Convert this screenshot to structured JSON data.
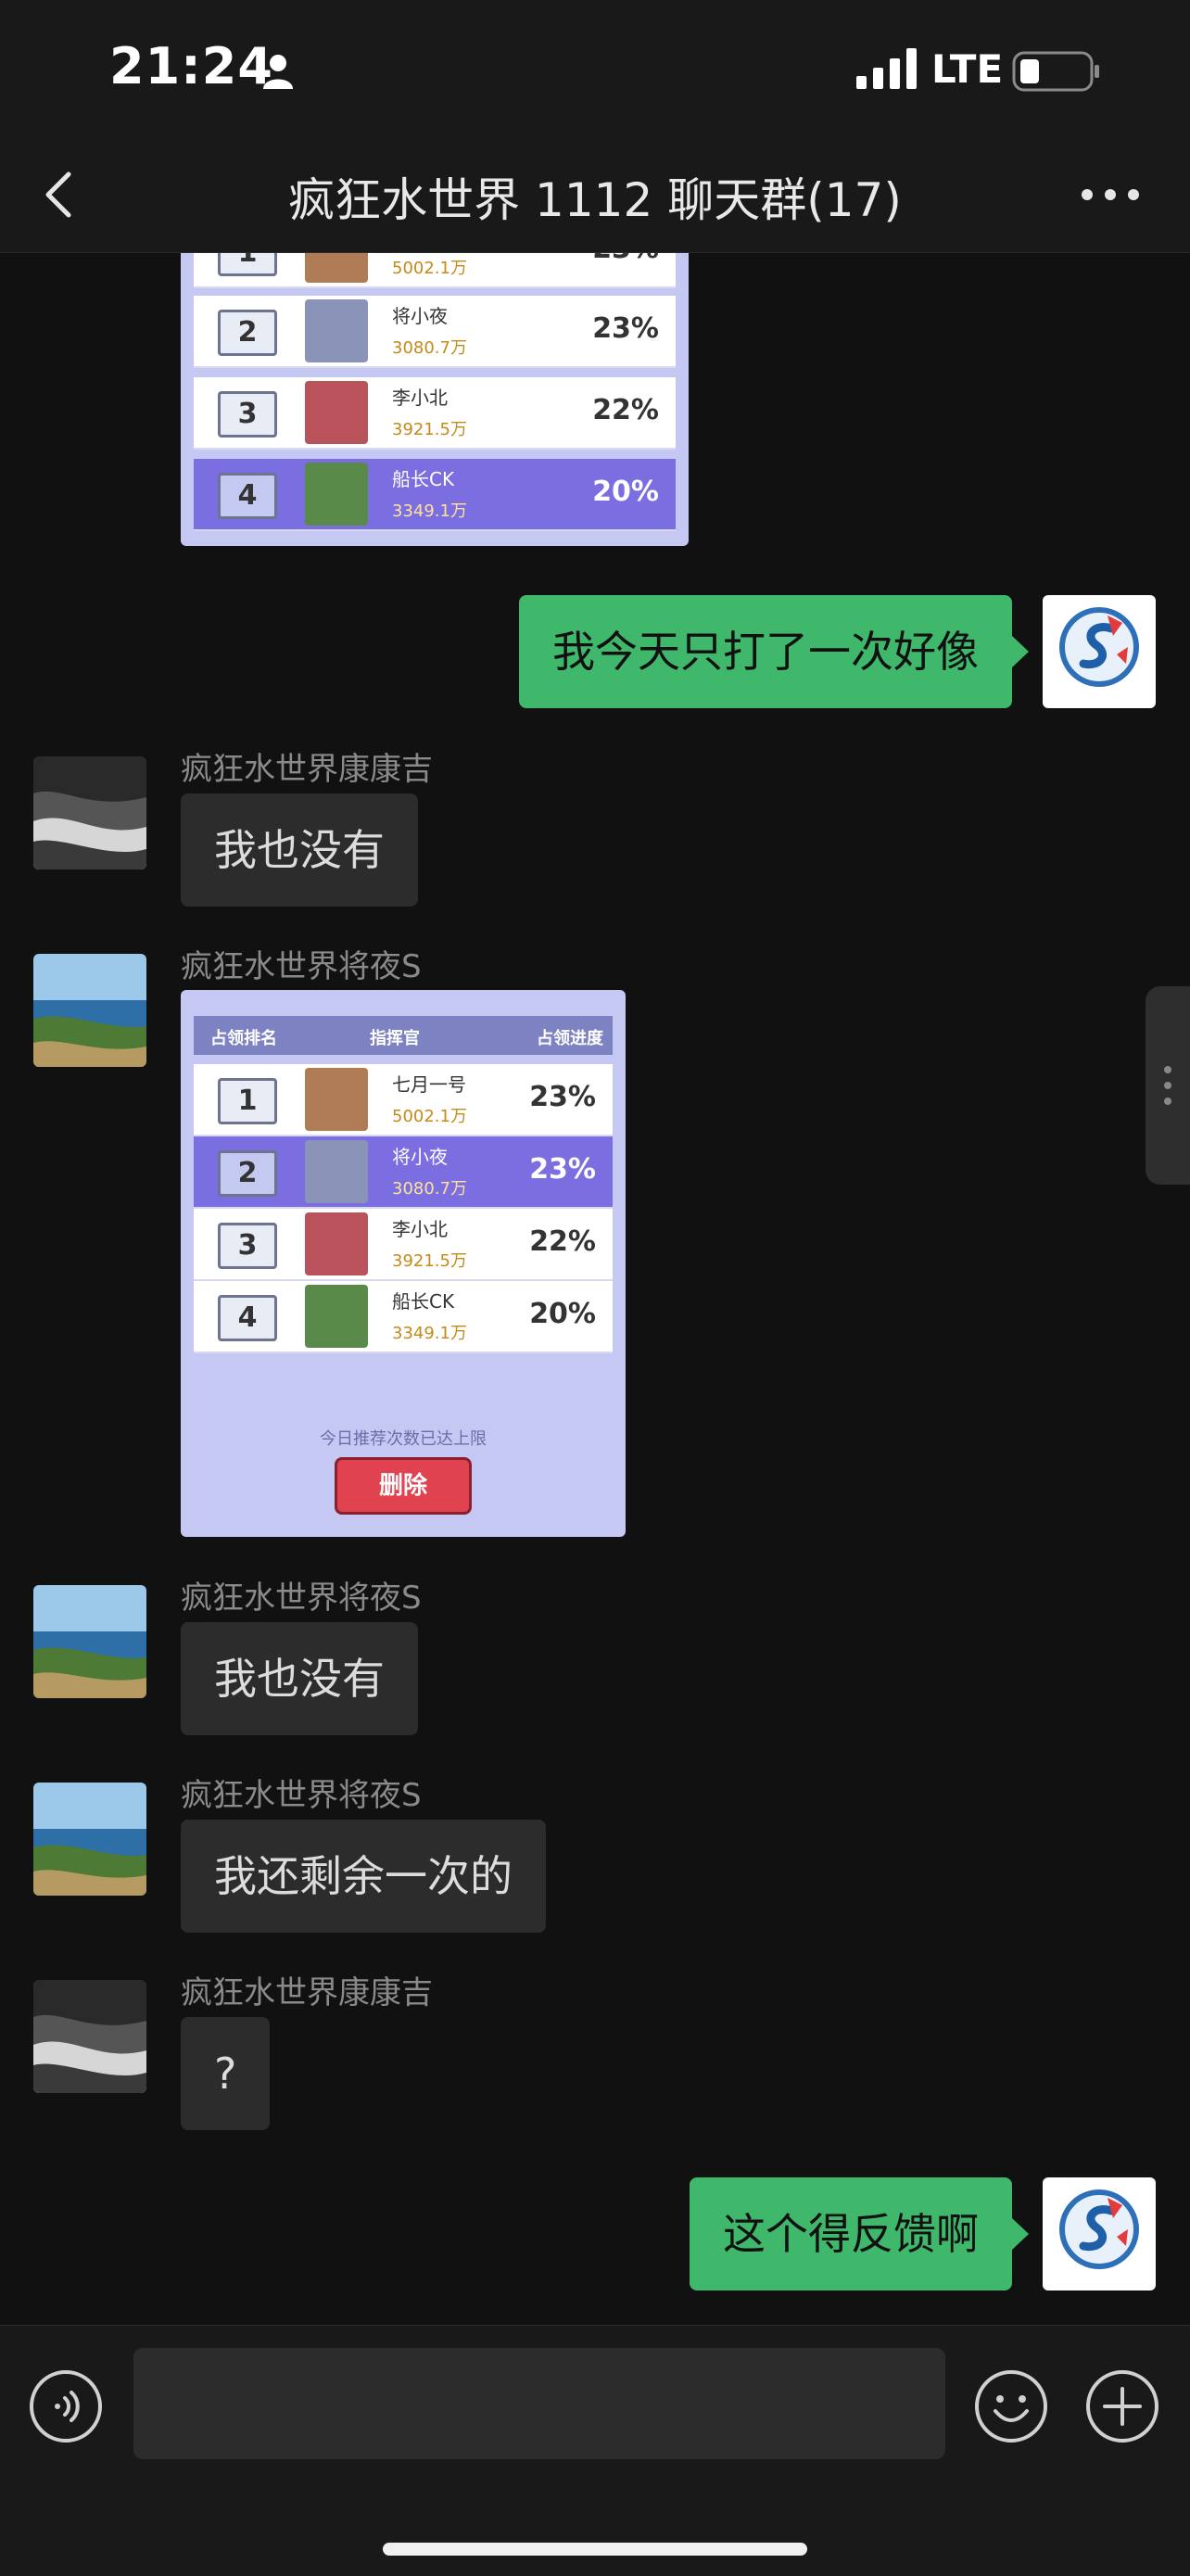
{
  "status_bar": {
    "time": "21:24",
    "network": "LTE"
  },
  "header": {
    "title": "疯狂水世界 1112 聊天群(17)"
  },
  "messages": [
    {
      "kind": "image",
      "side": "left",
      "rows": [
        {
          "rank": "1",
          "name": "",
          "power": "5002.1万",
          "percent": "23%"
        },
        {
          "rank": "2",
          "name": "将小夜",
          "power": "3080.7万",
          "percent": "23%"
        },
        {
          "rank": "3",
          "name": "李小北",
          "power": "3921.5万",
          "percent": "22%"
        },
        {
          "rank": "4",
          "name": "船长CK",
          "power": "3349.1万",
          "percent": "20%",
          "highlight": true
        }
      ]
    },
    {
      "kind": "text",
      "side": "right",
      "text": "我今天只打了一次好像"
    },
    {
      "kind": "text",
      "side": "left",
      "sender": "疯狂水世界康康吉",
      "text": "我也没有"
    },
    {
      "kind": "image",
      "side": "left",
      "sender": "疯狂水世界将夜S",
      "header": [
        "占领排名",
        "指挥官",
        "占领进度"
      ],
      "rows": [
        {
          "rank": "1",
          "name": "七月一号",
          "power": "5002.1万",
          "percent": "23%"
        },
        {
          "rank": "2",
          "name": "将小夜",
          "power": "3080.7万",
          "percent": "23%",
          "highlight": true
        },
        {
          "rank": "3",
          "name": "李小北",
          "power": "3921.5万",
          "percent": "22%"
        },
        {
          "rank": "4",
          "name": "船长CK",
          "power": "3349.1万",
          "percent": "20%"
        }
      ],
      "note": "今日推荐次数已达上限",
      "button": "删除"
    },
    {
      "kind": "text",
      "side": "left",
      "sender": "疯狂水世界将夜S",
      "text": "我也没有"
    },
    {
      "kind": "text",
      "side": "left",
      "sender": "疯狂水世界将夜S",
      "text": "我还剩余一次的"
    },
    {
      "kind": "text",
      "side": "left",
      "sender": "疯狂水世界康康吉",
      "text": "?"
    },
    {
      "kind": "text",
      "side": "right",
      "text": "这个得反馈啊"
    }
  ],
  "colors": {
    "background": "#111111",
    "bar": "#191919",
    "incoming_bubble": "#2c2c2c",
    "outgoing_bubble": "#3fb86c",
    "game_panel": "#c6c8f4",
    "highlight_row": "#7a6ee0",
    "delete_button": "#e0424f"
  },
  "icons": [
    "person-icon",
    "signal-icon",
    "battery-icon",
    "back-icon",
    "more-icon",
    "voice-icon",
    "emoji-icon",
    "plus-icon",
    "ellipsis-handle-icon"
  ]
}
